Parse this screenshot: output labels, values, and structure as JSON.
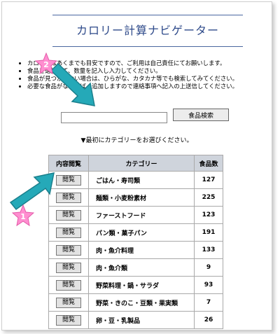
{
  "title": "カロリー計算ナビゲーター",
  "notes": [
    "カロリーはあくまでも目安ですので、ご利用は自己責任にてお願いします。",
    "食品を選択して、数量を記入し入力してください。",
    "食品が見つからない場合は、ひらがな、カタカナ等でも検索してみてください。",
    "必要な食品がなければ、追加しますので連絡事項へ記入の上送信してください。"
  ],
  "search": {
    "value": "",
    "button_label": "食品検索"
  },
  "instruction": "▼最初にカテゴリーをお選びください。",
  "table": {
    "headers": [
      "内容閲覧",
      "カテゴリー",
      "食品数"
    ],
    "view_label": "閲覧",
    "rows": [
      {
        "category": "ごはん・寿司類",
        "count": "127"
      },
      {
        "category": "麺類・小麦粉素材",
        "count": "225"
      },
      {
        "category": "ファーストフード",
        "count": "123"
      },
      {
        "category": "パン類・菓子パン",
        "count": "191"
      },
      {
        "category": "肉・魚介料理",
        "count": "133"
      },
      {
        "category": "肉・魚介類",
        "count": "9"
      },
      {
        "category": "野菜料理・鍋・サラダ",
        "count": "93"
      },
      {
        "category": "野菜・きのこ・豆類・果実類",
        "count": "7"
      },
      {
        "category": "卵・豆・乳製品",
        "count": "26"
      }
    ]
  },
  "markers": [
    "2",
    "1"
  ],
  "colors": {
    "arrow": "#25a9b8",
    "star": "#ff8ed0",
    "title": "#2e4a8a",
    "header_bg": "#cfd4dc"
  }
}
